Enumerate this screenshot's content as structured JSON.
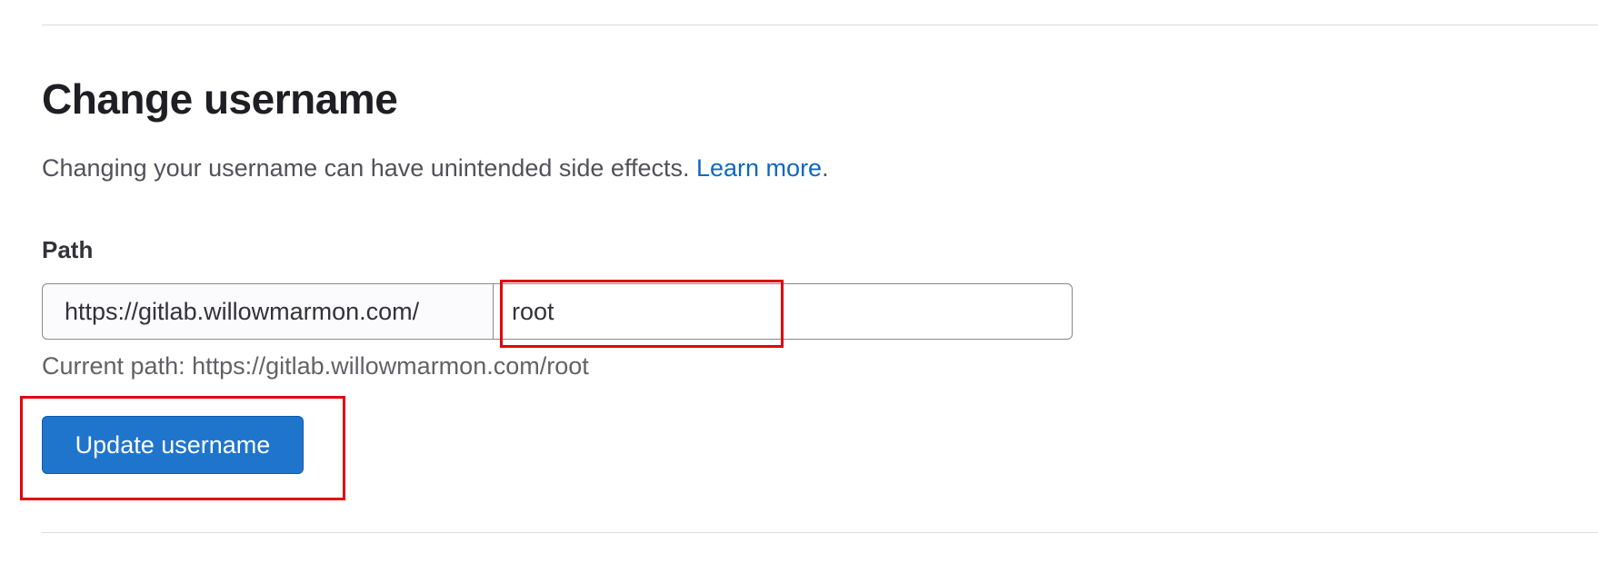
{
  "section": {
    "title": "Change username",
    "description": "Changing your username can have unintended side effects.",
    "learn_more_label": "Learn more",
    "description_suffix": "."
  },
  "path_field": {
    "label": "Path",
    "prefix": "https://gitlab.willowmarmon.com/",
    "value": "root",
    "current_path": "Current path: https://gitlab.willowmarmon.com/root"
  },
  "actions": {
    "update_label": "Update username"
  },
  "colors": {
    "accent": "#1f75cb",
    "link": "#1068bf",
    "highlight": "#e3000f"
  }
}
